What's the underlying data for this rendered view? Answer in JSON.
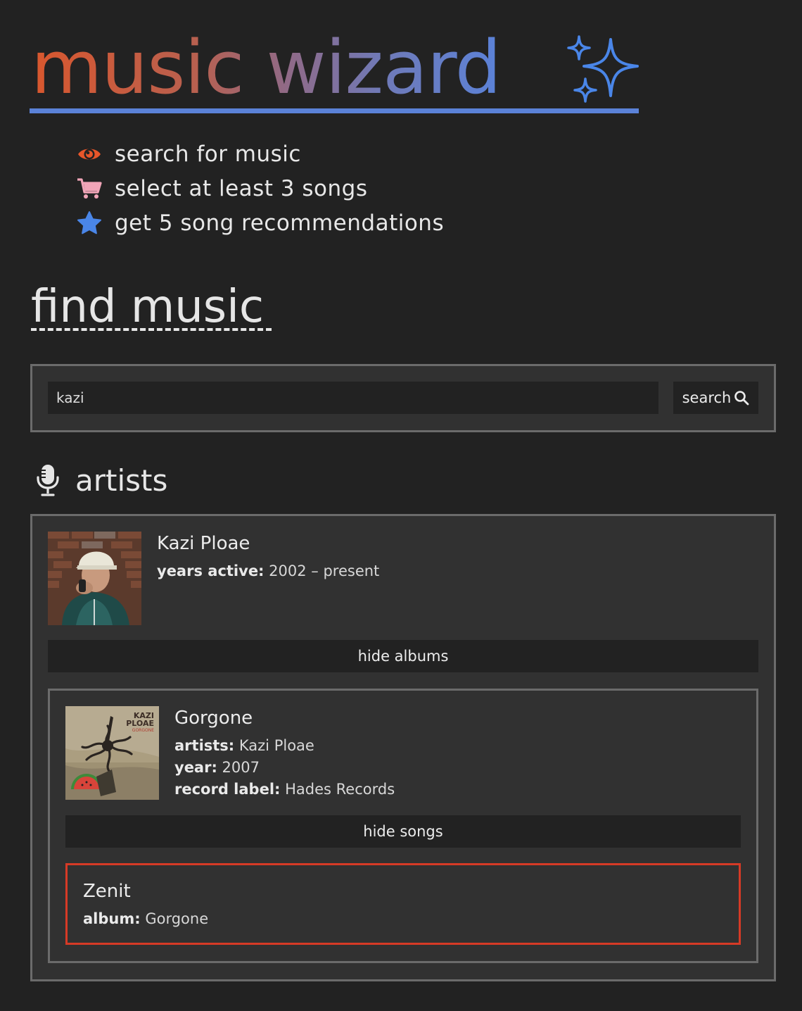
{
  "header": {
    "title": "music wizard",
    "sparkle_icon": "sparkles-icon",
    "accent_colors": {
      "orange": "#d9572e",
      "blue": "#5b82d8"
    }
  },
  "steps": [
    {
      "icon": "eye-icon",
      "color": "#e8562a",
      "text": "search for music"
    },
    {
      "icon": "cart-icon",
      "color": "#f1a5b8",
      "text": "select at least 3 songs"
    },
    {
      "icon": "star-icon",
      "color": "#4a86e8",
      "text": "get 5 song recommendations"
    }
  ],
  "find_section": {
    "title": "find music"
  },
  "search": {
    "value": "kazi",
    "placeholder": "",
    "button_label": "search",
    "button_icon": "magnifier-icon"
  },
  "artists_section": {
    "icon": "microphone-icon",
    "title": "artists"
  },
  "artist": {
    "name": "Kazi Ploae",
    "years_label": "years active:",
    "years_value": "2002 – present",
    "toggle_albums_label": "hide albums",
    "album": {
      "title": "Gorgone",
      "artists_label": "artists:",
      "artists_value": "Kazi Ploae",
      "year_label": "year:",
      "year_value": "2007",
      "record_label_label": "record label:",
      "record_label_value": "Hades Records",
      "cover_text": [
        "KAZI",
        "PLOAE",
        "GORGONE"
      ],
      "toggle_songs_label": "hide songs",
      "song": {
        "title": "Zenit",
        "album_label": "album:",
        "album_value": "Gorgone",
        "selected_border_color": "#d63a26"
      }
    }
  }
}
